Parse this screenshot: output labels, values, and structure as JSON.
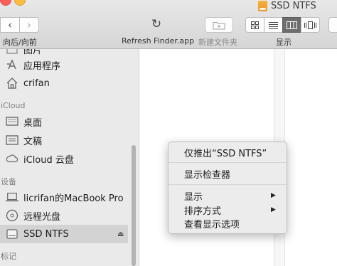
{
  "window": {
    "title": "SSD NTFS"
  },
  "toolbar": {
    "back_forward_label": "向后/向前",
    "refresh_label": "Refresh Finder.app",
    "new_folder_label": "新建文件夹",
    "view_label": "显示",
    "refresh_icon": "refresh-icon",
    "new_folder_icon": "new-folder-icon",
    "view_modes": [
      "icon-view",
      "list-view",
      "column-view",
      "cover-flow-view"
    ],
    "active_view": "column-view"
  },
  "sidebar": {
    "partial_top_label": "图片",
    "favorites": [
      {
        "label": "应用程序",
        "icon": "applications-icon"
      },
      {
        "label": "crifan",
        "icon": "home-icon"
      }
    ],
    "icloud_header": "iCloud",
    "icloud": [
      {
        "label": "桌面",
        "icon": "desktop-icon"
      },
      {
        "label": "文稿",
        "icon": "documents-icon"
      },
      {
        "label": "iCloud 云盘",
        "icon": "icloud-icon"
      }
    ],
    "devices_header": "设备",
    "devices": [
      {
        "label": "licrifan的MacBook Pro",
        "icon": "laptop-icon"
      },
      {
        "label": "远程光盘",
        "icon": "disc-icon"
      },
      {
        "label": "SSD NTFS",
        "icon": "drive-icon",
        "selected": true
      }
    ],
    "tags_header": "标记"
  },
  "context_menu": {
    "items": [
      {
        "label": "仅推出“SSD NTFS”"
      },
      {
        "label": "显示检查器"
      },
      {
        "label": "显示",
        "submenu": true
      },
      {
        "label": "排序方式",
        "submenu": true
      },
      {
        "label": "查看显示选项"
      }
    ],
    "submenu_arrow": "▶"
  },
  "colors": {
    "close": "#fc605c",
    "minimize": "#fdbc40",
    "drive": "#f0a536",
    "selected_row": "#d4d3d4"
  }
}
